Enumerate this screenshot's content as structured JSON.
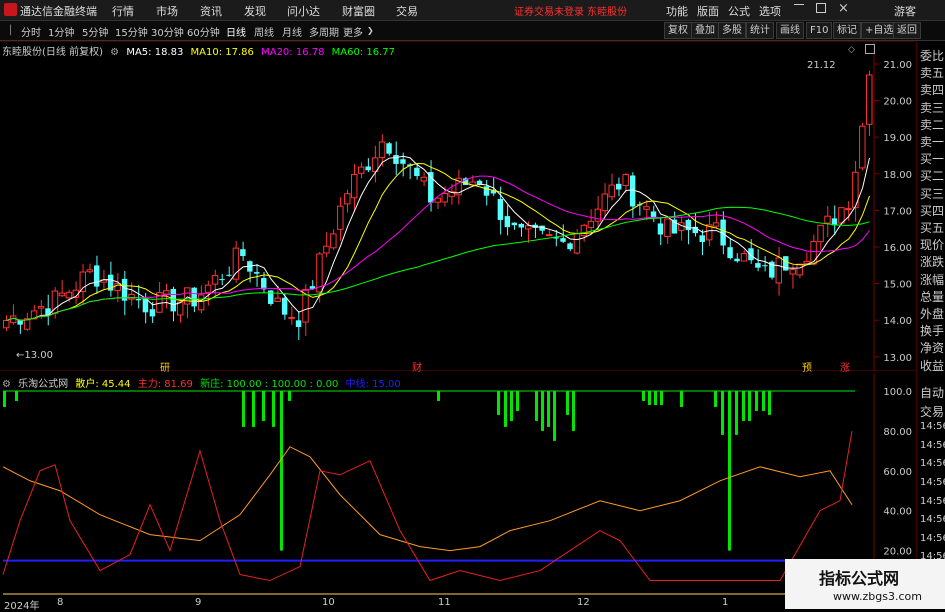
{
  "titlebar": {
    "app_name": "通达信金融终端",
    "menus": [
      "行情",
      "市场",
      "资讯",
      "发现",
      "问小达",
      "财富圈",
      "交易"
    ],
    "notice": "证券交易未登录  东睦股份",
    "right_menus": [
      "功能",
      "版面",
      "公式",
      "选项"
    ],
    "guest": "游客"
  },
  "toolbar": {
    "periods": [
      "分时",
      "1分钟",
      "5分钟",
      "15分钟",
      "30分钟",
      "60分钟",
      "日线",
      "周线",
      "月线",
      "多周期",
      "更多"
    ],
    "active_period": "日线",
    "right_buttons": [
      "复权",
      "叠加",
      "多股",
      "统计",
      "画线",
      "F10",
      "标记",
      "+自选",
      "返回"
    ]
  },
  "main_legend": {
    "stock": "东睦股份(日线 前复权)",
    "ma5": "MA5: 18.83",
    "ma10": "MA10: 17.86",
    "ma20": "MA20: 16.78",
    "ma60": "MA60: 16.77"
  },
  "price_axis": [
    "21.00",
    "20.00",
    "19.00",
    "18.00",
    "17.00",
    "16.00",
    "15.00",
    "14.00",
    "13.00"
  ],
  "annotations": {
    "high_label": "21.12",
    "low_label": "13.00",
    "marks": [
      "研",
      "财",
      "预",
      "涨"
    ]
  },
  "indicator_legend": {
    "name": "乐淘公式网",
    "sanhu": "散户: 45.44",
    "zhuli": "主力: 81.69",
    "xinzhuang": "新庄: 100.00 : 100.00 : 0.00",
    "zhongxian": "中线: 15.00"
  },
  "indicator_axis": [
    "100.0",
    "80.00",
    "60.00",
    "40.00",
    "20.00"
  ],
  "date_axis": [
    "2024年",
    "8",
    "9",
    "10",
    "11",
    "12",
    "1"
  ],
  "right_panel": [
    "委比",
    "卖五",
    "卖四",
    "卖三",
    "卖二",
    "卖一",
    "买一",
    "买二",
    "买三",
    "买四",
    "买五",
    "现价",
    "涨跌",
    "涨幅",
    "总量",
    "外盘",
    "换手",
    "净资",
    "收益"
  ],
  "right_panel_lower": [
    "自动",
    "交易",
    "14:56",
    "14:56",
    "14:56",
    "14:56",
    "14:56",
    "14:56",
    "14:56",
    "14:56",
    "14:56"
  ],
  "watermark": {
    "line1": "指标公式网",
    "line2": "www.zbgs3.com"
  },
  "colors": {
    "up": "#ff3232",
    "down": "#54ffff",
    "ma5": "#ffffff",
    "ma10": "#ffff00",
    "ma20": "#ff00ff",
    "ma60": "#00ff00",
    "green_bar": "#00e600",
    "orange": "#ff9a28",
    "red_line": "#e82020",
    "blue_line": "#2020ff"
  }
}
